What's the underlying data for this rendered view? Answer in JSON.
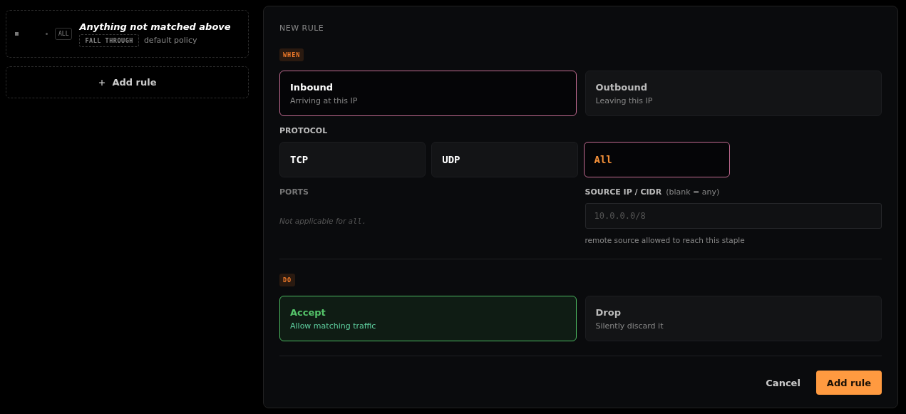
{
  "rules": [
    {
      "scope": "ALL",
      "title": "Anything not matched above",
      "action": "FALL THROUGH",
      "note": "default policy"
    }
  ],
  "add_rule": "Add rule",
  "form": {
    "title": "NEW RULE",
    "when": {
      "badge": "WHEN",
      "options": [
        {
          "label": "Inbound",
          "sub": "Arriving at this IP",
          "selected": true
        },
        {
          "label": "Outbound",
          "sub": "Leaving this IP",
          "selected": false
        }
      ]
    },
    "protocol": {
      "label": "PROTOCOL",
      "options": [
        {
          "label": "TCP",
          "selected": false
        },
        {
          "label": "UDP",
          "selected": false
        },
        {
          "label": "All",
          "selected": true
        }
      ]
    },
    "ports": {
      "label": "PORTS",
      "note": "Not applicable for",
      "note_code": "all."
    },
    "source": {
      "label": "SOURCE IP / CIDR",
      "label_hint": "(blank = any)",
      "placeholder": "10.0.0.0/8",
      "help": "remote source allowed to reach this staple"
    },
    "do": {
      "badge": "DO",
      "options": [
        {
          "label": "Accept",
          "sub": "Allow matching traffic",
          "selected": true
        },
        {
          "label": "Drop",
          "sub": "Silently discard it",
          "selected": false
        }
      ]
    },
    "buttons": {
      "cancel": "Cancel",
      "submit": "Add rule"
    }
  }
}
